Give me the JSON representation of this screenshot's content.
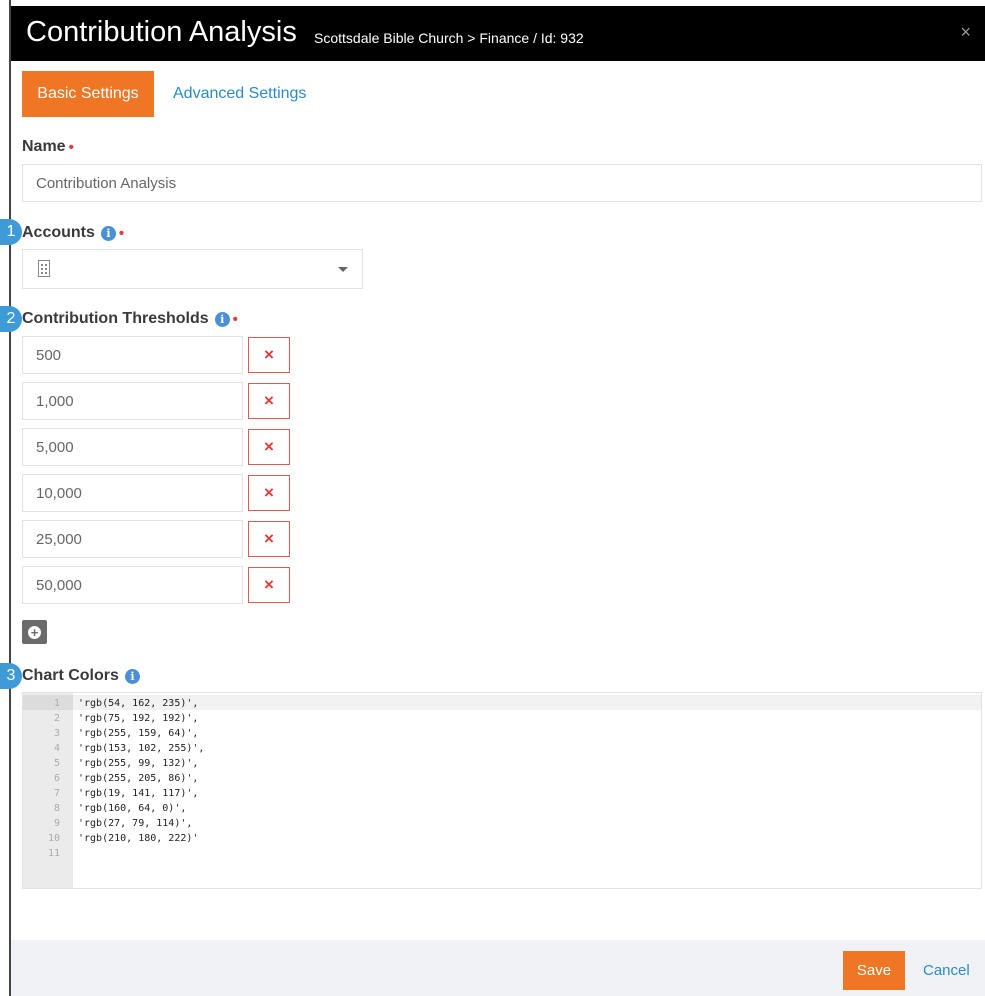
{
  "header": {
    "title": "Contribution Analysis",
    "subtitle": "Scottsdale Bible Church > Finance / Id: 932",
    "close_label": "×"
  },
  "tabs": [
    {
      "label": "Basic Settings",
      "active": true
    },
    {
      "label": "Advanced Settings",
      "active": false
    }
  ],
  "form": {
    "name_label": "Name",
    "name_value": "Contribution Analysis",
    "accounts_label": "Accounts",
    "thresholds_label": "Contribution Thresholds",
    "thresholds": [
      "500",
      "1,000",
      "5,000",
      "10,000",
      "25,000",
      "50,000"
    ],
    "chart_colors_label": "Chart Colors",
    "required_marker": "•",
    "info_glyph": "i",
    "remove_glyph": "×",
    "add_glyph": "+"
  },
  "badges": [
    "1",
    "2",
    "3"
  ],
  "editor": {
    "line_numbers": [
      "1",
      "2",
      "3",
      "4",
      "5",
      "6",
      "7",
      "8",
      "9",
      "10",
      "11"
    ],
    "lines": [
      "'rgb(54, 162, 235)',",
      "'rgb(75, 192, 192)',",
      "'rgb(255, 159, 64)',",
      "'rgb(153, 102, 255)',",
      "'rgb(255, 99, 132)',",
      "'rgb(255, 205, 86)',",
      "'rgb(19, 141, 117)',",
      "'rgb(160, 64, 0)',",
      "'rgb(27, 79, 114)',",
      "'rgb(210, 180, 222)'",
      ""
    ]
  },
  "footer": {
    "save_label": "Save",
    "cancel_label": "Cancel"
  },
  "colors": {
    "accent_orange": "#ee7624",
    "link_blue": "#2a8bc7",
    "badge_blue": "#3f9ad8",
    "required_red": "#e23c3c",
    "header_black": "#000000"
  },
  "icons": {
    "close": "close-icon",
    "info": "info-icon",
    "building": "building-icon",
    "caret": "chevron-down-icon",
    "remove": "remove-icon",
    "add": "add-circle-icon"
  }
}
